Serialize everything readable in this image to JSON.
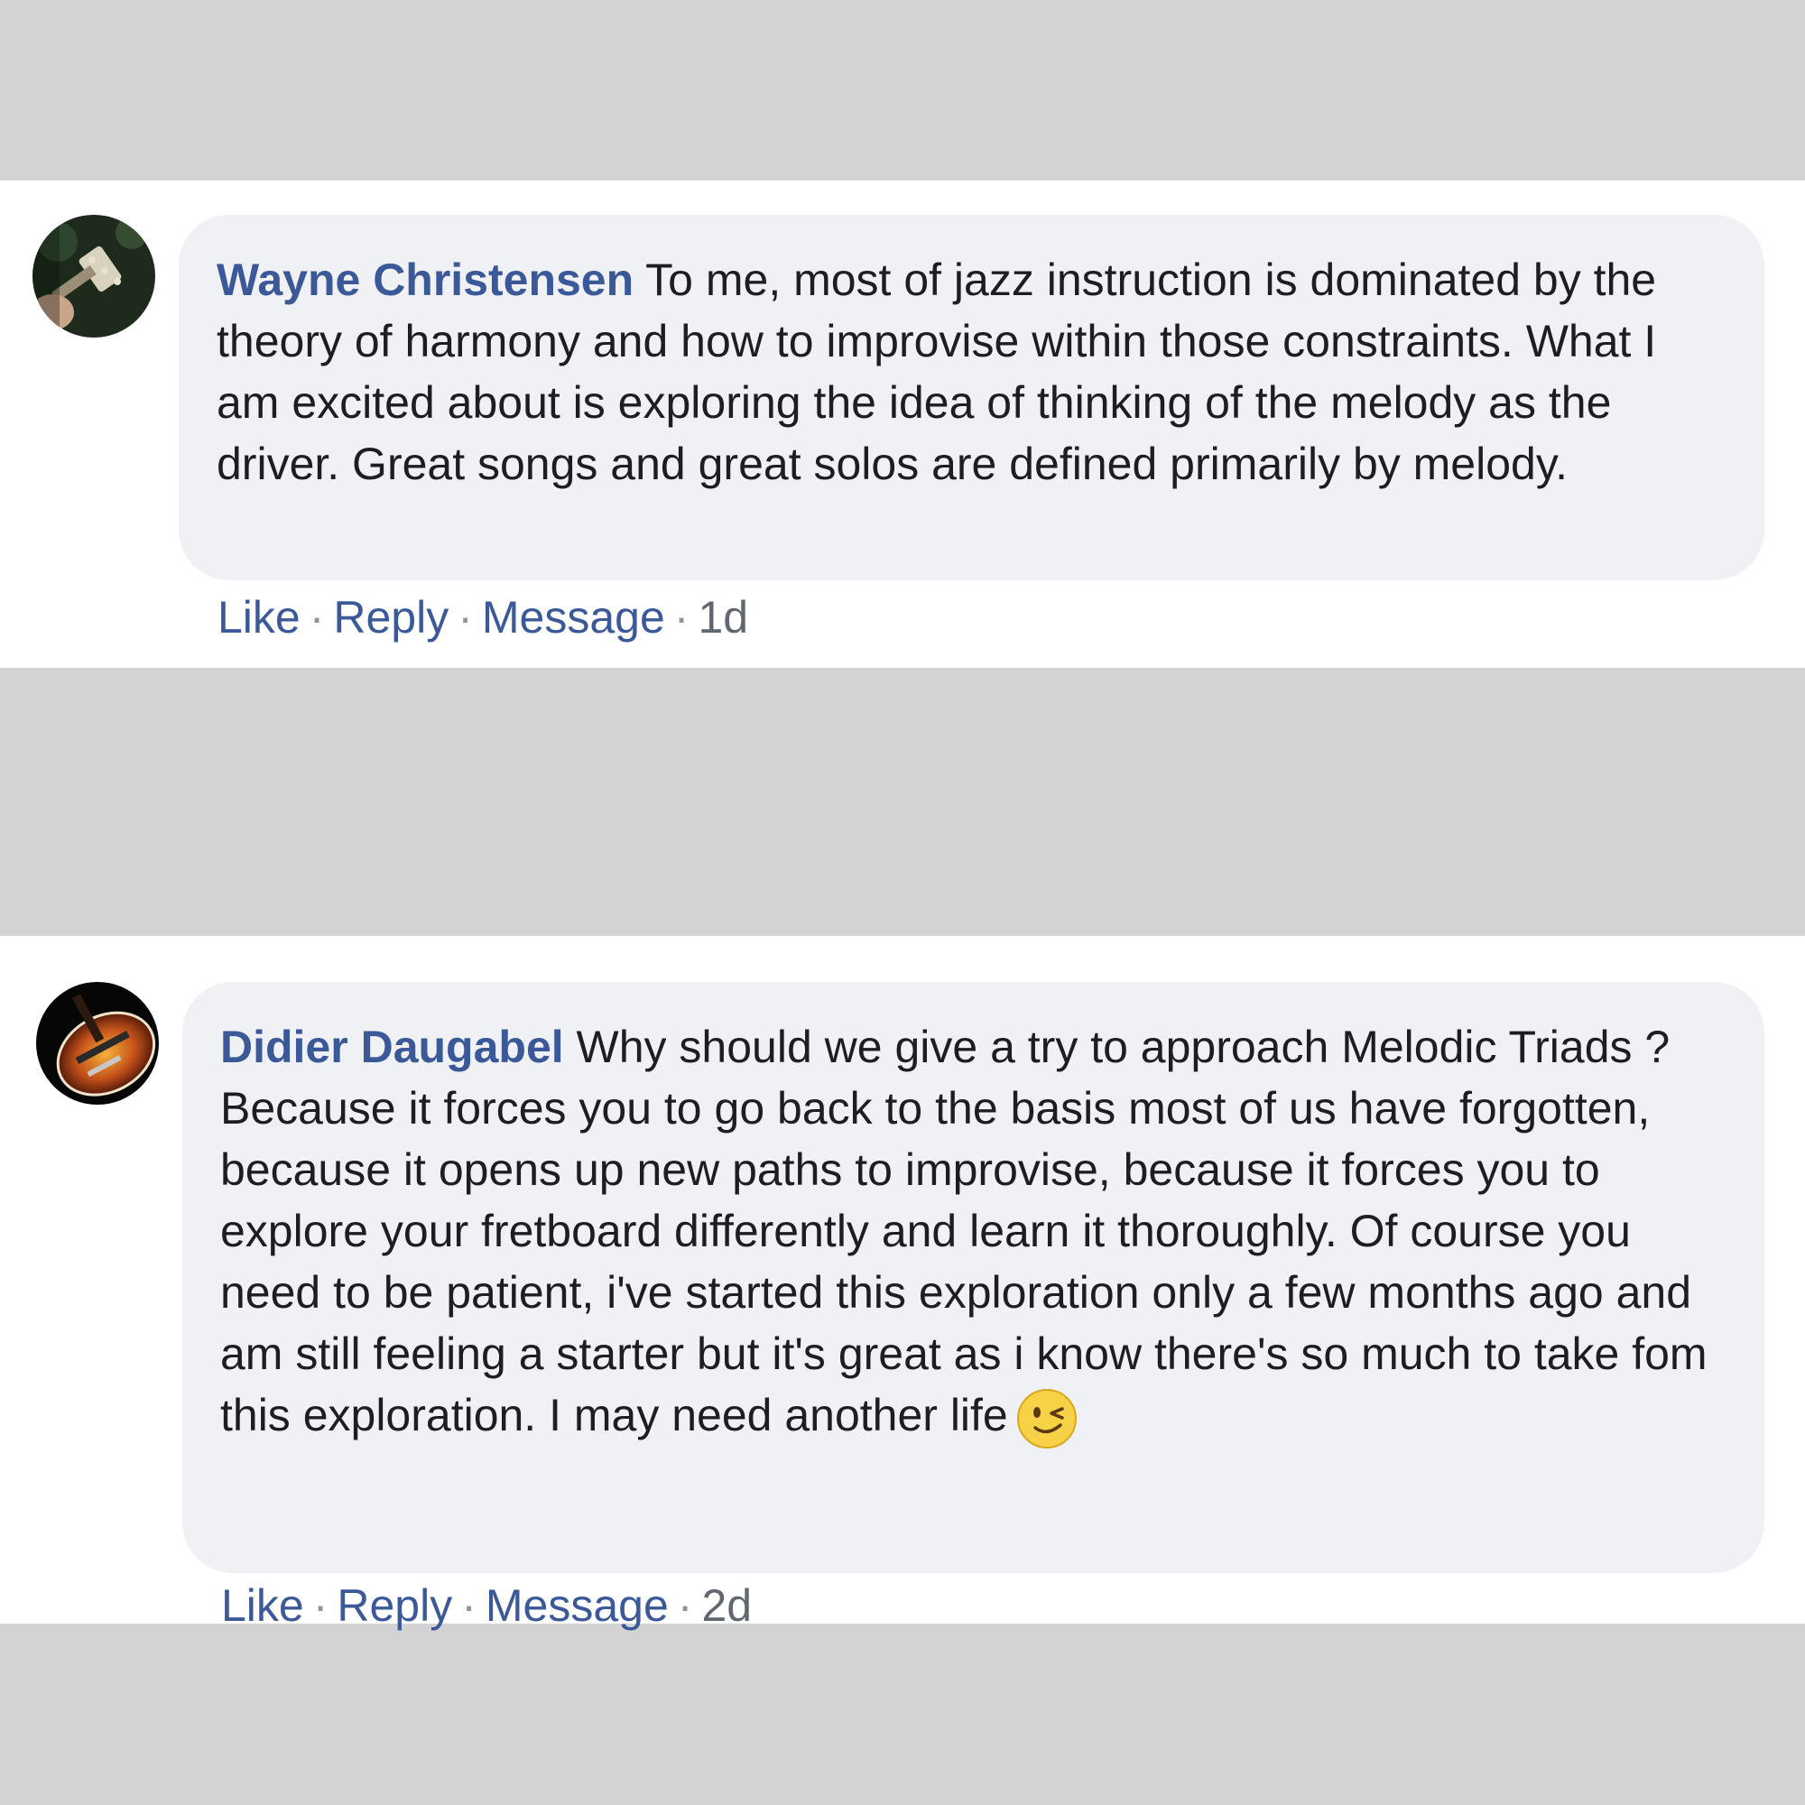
{
  "comments": [
    {
      "author": "Wayne Christensen",
      "text": " To me, most of jazz instruction is dominated by the theory of harmony and how to improvise within those constraints. What I am excited about is exploring the idea of thinking of the melody as the driver. Great songs and great solos are defined primarily by melody.",
      "avatar_icon": "guitar-headstock-photo",
      "actions": {
        "like": "Like",
        "reply": "Reply",
        "message": "Message",
        "separator": "·"
      },
      "timestamp": "1d"
    },
    {
      "author": "Didier Daugabel",
      "text": " Why should we give a try to approach Melodic Triads ? Because it forces you to go back to the basis most of us have forgotten, because it opens up new paths to improvise, because it forces you to explore your fretboard differently and learn it thoroughly. Of course you need to be patient, i've started this exploration only a few months ago and am still feeling a starter but it's great as i know there's so much to take fom this exploration. I may need another life",
      "avatar_icon": "sunburst-guitar-photo",
      "emoji": "winking-face-emoji",
      "actions": {
        "like": "Like",
        "reply": "Reply",
        "message": "Message",
        "separator": "·"
      },
      "timestamp": "2d"
    }
  ],
  "colors": {
    "background": "#d3d3d3",
    "panel": "#ffffff",
    "bubble": "#f0f1f4",
    "author": "#3b5998",
    "link": "#3b5998",
    "body_text": "#1c1e21",
    "timestamp": "#616770"
  }
}
